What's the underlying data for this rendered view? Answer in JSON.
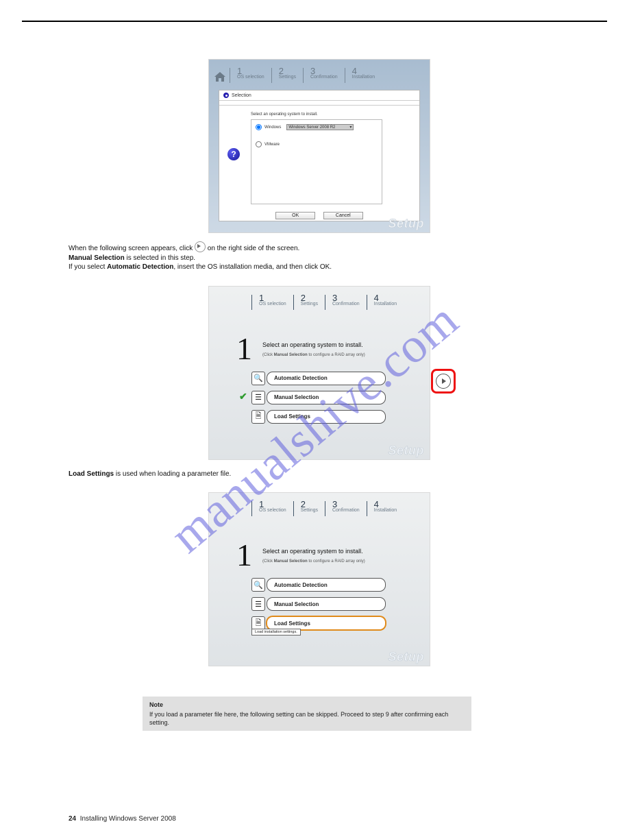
{
  "watermark": "manualshive.com",
  "brand": "Setup",
  "steps": [
    {
      "n": "1",
      "l": "OS selection"
    },
    {
      "n": "2",
      "l": "Settings"
    },
    {
      "n": "3",
      "l": "Confirmation"
    },
    {
      "n": "4",
      "l": "Installation"
    }
  ],
  "dialog": {
    "title": "Selection",
    "prompt": "Select an operating system to install.",
    "opts": [
      "Windows",
      "VMware"
    ],
    "winver": "Windows Server 2008 R2",
    "ok": "OK",
    "cancel": "Cancel"
  },
  "text1": {
    "a": "When the following screen appears, click ",
    "b": " on the right side of the screen.",
    "bold1": "Manual Selection",
    "c": " is selected in this step.",
    "d": "If you select ",
    "bold2": "Automatic Detection",
    "e": ", insert the OS installation media, and then click OK."
  },
  "panel": {
    "big": "1",
    "title": "Select an operating system to install.",
    "sub_a": "(Click ",
    "sub_b": "Manual Selection",
    "sub_c": " to configure a RAID array only)",
    "options": [
      "Automatic Detection",
      "Manual Selection",
      "Load Settings"
    ]
  },
  "text2": {
    "bold": "Load Settings",
    "a": " is used when loading a parameter file."
  },
  "panel3": {
    "tip": "Load installation settings."
  },
  "note": {
    "t": "Note",
    "b": "If you load a parameter file here, the following setting can be skipped. Proceed to step 9 after confirming each setting."
  },
  "footer": {
    "pg": "24",
    "txt": "Installing Windows Server 2008"
  }
}
